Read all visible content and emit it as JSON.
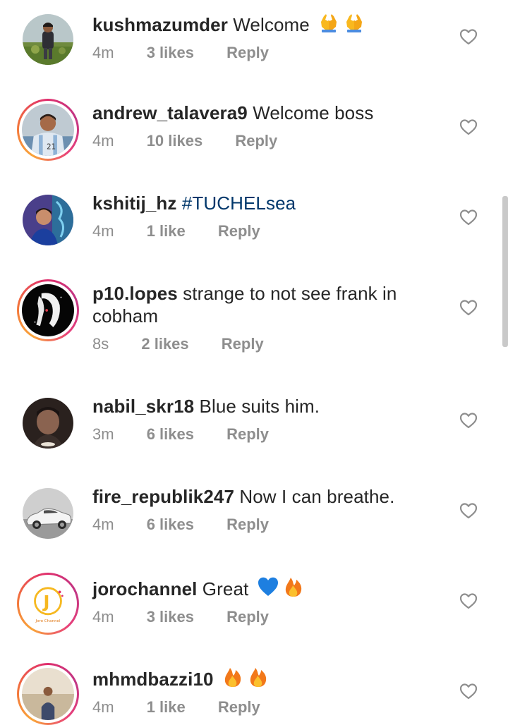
{
  "comments": [
    {
      "username": "kushmazumder",
      "text": "Welcome",
      "emojis": [
        "folded-hands",
        "folded-hands"
      ],
      "time": "4m",
      "likes": "3 likes",
      "reply": "Reply",
      "avatar_ring": false
    },
    {
      "username": "andrew_talavera9",
      "text": "Welcome boss",
      "emojis": [],
      "time": "4m",
      "likes": "10 likes",
      "reply": "Reply",
      "avatar_ring": true,
      "jersey_number": "21"
    },
    {
      "username": "kshitij_hz",
      "text": "#TUCHELsea",
      "emojis": [],
      "time": "4m",
      "likes": "1 like",
      "reply": "Reply",
      "avatar_ring": false
    },
    {
      "username": "p10.lopes",
      "text": "strange to not see frank in cobham",
      "text_line1": "strange to not see frank in",
      "text_line2": "cobham",
      "emojis": [],
      "time": "8s",
      "likes": "2 likes",
      "reply": "Reply",
      "avatar_ring": true
    },
    {
      "username": "nabil_skr18",
      "text": "Blue suits him.",
      "emojis": [],
      "time": "3m",
      "likes": "6 likes",
      "reply": "Reply",
      "avatar_ring": false
    },
    {
      "username": "fire_republik247",
      "text": "Now I can breathe.",
      "emojis": [],
      "time": "4m",
      "likes": "6 likes",
      "reply": "Reply",
      "avatar_ring": false
    },
    {
      "username": "jorochannel",
      "text": "Great",
      "emojis": [
        "blue-heart",
        "fire"
      ],
      "time": "4m",
      "likes": "3 likes",
      "reply": "Reply",
      "avatar_ring": true,
      "logo_letter": "J",
      "logo_caption": "Joro Channel"
    },
    {
      "username": "mhmdbazzi10",
      "text": "",
      "emojis": [
        "fire",
        "fire"
      ],
      "time": "4m",
      "likes": "1 like",
      "reply": "Reply",
      "avatar_ring": true
    }
  ],
  "colors": {
    "text": "#262626",
    "meta": "#8e8e8e",
    "hashtag": "#00376b",
    "story_ring_start": "#f9a43a",
    "story_ring_end": "#e1306c"
  },
  "icons": {
    "like": "heart-outline-icon",
    "emoji_folded_hands": "folded-hands-emoji",
    "emoji_blue_heart": "blue-heart-emoji",
    "emoji_fire": "fire-emoji"
  }
}
